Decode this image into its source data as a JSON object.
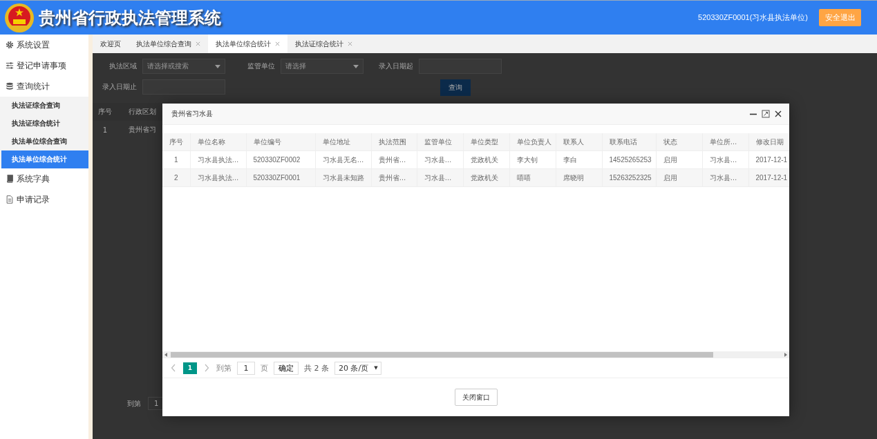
{
  "header": {
    "title": "贵州省行政执法管理系统",
    "user": "520330ZF0001(习水县执法单位)",
    "logout": "安全退出"
  },
  "sidebar": {
    "items": [
      {
        "label": "系统设置"
      },
      {
        "label": "登记申请事项"
      },
      {
        "label": "查询统计",
        "children": [
          {
            "label": "执法证综合查询",
            "selected": false
          },
          {
            "label": "执法证综合统计",
            "selected": false
          },
          {
            "label": "执法单位综合查询",
            "selected": false
          },
          {
            "label": "执法单位综合统计",
            "selected": true
          }
        ]
      },
      {
        "label": "系统字典"
      },
      {
        "label": "申请记录"
      }
    ]
  },
  "tabs": [
    {
      "label": "欢迎页",
      "closable": false,
      "selected": false
    },
    {
      "label": "执法单位综合查询",
      "closable": true,
      "selected": false
    },
    {
      "label": "执法单位综合统计",
      "closable": true,
      "selected": true
    },
    {
      "label": "执法证综合统计",
      "closable": true,
      "selected": false
    }
  ],
  "background_page": {
    "filters": [
      {
        "label": "执法区域",
        "placeholder": "请选择或搜索",
        "kind": "select"
      },
      {
        "label": "监管单位",
        "placeholder": "请选择",
        "kind": "select"
      },
      {
        "label": "录入日期起",
        "kind": "input"
      },
      {
        "label": "录入日期止",
        "kind": "input"
      }
    ],
    "search_button": "查询",
    "columns": [
      "序号",
      "行政区划"
    ],
    "rows": [
      [
        "1",
        "贵州省习"
      ]
    ],
    "pager_label": "到第",
    "pager_value": "1"
  },
  "dialog": {
    "title": "贵州省习水县",
    "columns": [
      "序号",
      "单位名称",
      "单位编号",
      "单位地址",
      "执法范围",
      "监管单位",
      "单位类型",
      "单位负责人",
      "联系人",
      "联系电话",
      "状态",
      "单位所…",
      "修改日期"
    ],
    "rows": [
      [
        "1",
        "习水县执法…",
        "520330ZF0002",
        "习水县无名…",
        "贵州省…",
        "习水县…",
        "党政机关",
        "李大钊",
        "李白",
        "14525265253",
        "启用",
        "习水县…",
        "2017-12-1"
      ],
      [
        "2",
        "习水县执法…",
        "520330ZF0001",
        "习水县未知路",
        "贵州省…",
        "习水县…",
        "党政机关",
        "嘻嘻",
        "席晓明",
        "15263252325",
        "启用",
        "习水县…",
        "2017-12-1"
      ]
    ],
    "pager": {
      "pages": [
        {
          "label": "1",
          "selected": true
        }
      ],
      "goto_label": "到第",
      "goto_value": "1",
      "page_unit": "页",
      "confirm": "确定",
      "total": "共 2 条",
      "page_size": "20 条/页",
      "size_caret": "▼"
    },
    "close_button": "关闭窗口"
  }
}
